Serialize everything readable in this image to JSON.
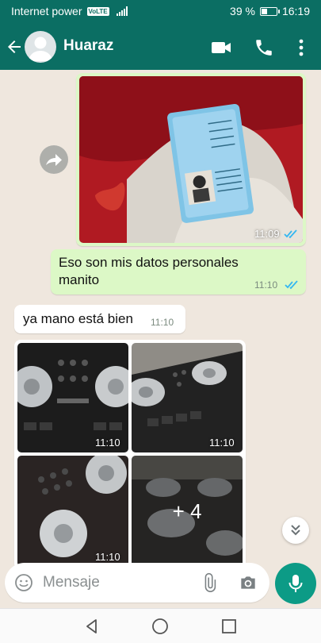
{
  "status_bar": {
    "carrier": "Internet power",
    "network_badge": "VoLTE",
    "battery_percent": "39 %",
    "battery_level": 0.39,
    "time": "16:19"
  },
  "header": {
    "contact_name": "Huaraz",
    "icons": [
      "back-arrow-icon",
      "avatar",
      "video-call-icon",
      "phone-icon",
      "more-options-icon"
    ]
  },
  "messages": [
    {
      "type": "image",
      "direction": "outgoing",
      "time": "11:09",
      "status": "read"
    },
    {
      "type": "text",
      "direction": "outgoing",
      "text": "Eso son mis datos personales manito",
      "time": "11:10",
      "status": "read"
    },
    {
      "type": "text",
      "direction": "incoming",
      "text": "ya mano está bien",
      "time": "11:10"
    },
    {
      "type": "image_group",
      "direction": "incoming",
      "times": [
        "11:10",
        "11:10",
        "11:10"
      ],
      "more_count": "+ 4"
    }
  ],
  "composer": {
    "placeholder": "Mensaje"
  },
  "colors": {
    "header": "#0b6e63",
    "outgoing_bubble": "#dcf8c6",
    "incoming_bubble": "#ffffff",
    "mic_button": "#0c9b86",
    "read_ticks": "#34b7f1"
  }
}
